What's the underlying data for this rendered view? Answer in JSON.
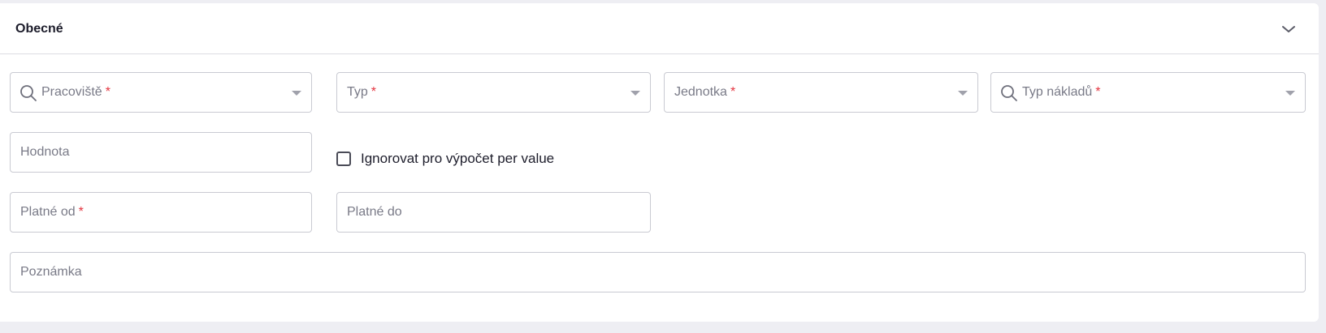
{
  "section": {
    "title": "Obecné"
  },
  "fields": {
    "pracoviste": {
      "label": "Pracoviště",
      "required_mark": "*"
    },
    "typ": {
      "label": "Typ",
      "required_mark": "*"
    },
    "jednotka": {
      "label": "Jednotka",
      "required_mark": "*"
    },
    "typ_nakladu": {
      "label": "Typ nákladů",
      "required_mark": "*"
    },
    "hodnota": {
      "label": "Hodnota"
    },
    "platne_od": {
      "label": "Platné od",
      "required_mark": "*"
    },
    "platne_do": {
      "label": "Platné do"
    },
    "poznamka": {
      "label": "Poznámka"
    }
  },
  "checkbox": {
    "label": "Ignorovat pro výpočet per value",
    "checked": false
  },
  "icons": {
    "collapse": "chevron-down-icon",
    "search": "search-icon",
    "dropdown": "caret-down-icon"
  },
  "colors": {
    "required": "#e4343f",
    "border": "#c9cad2",
    "placeholder": "#797a87",
    "background": "#eeeef3"
  }
}
